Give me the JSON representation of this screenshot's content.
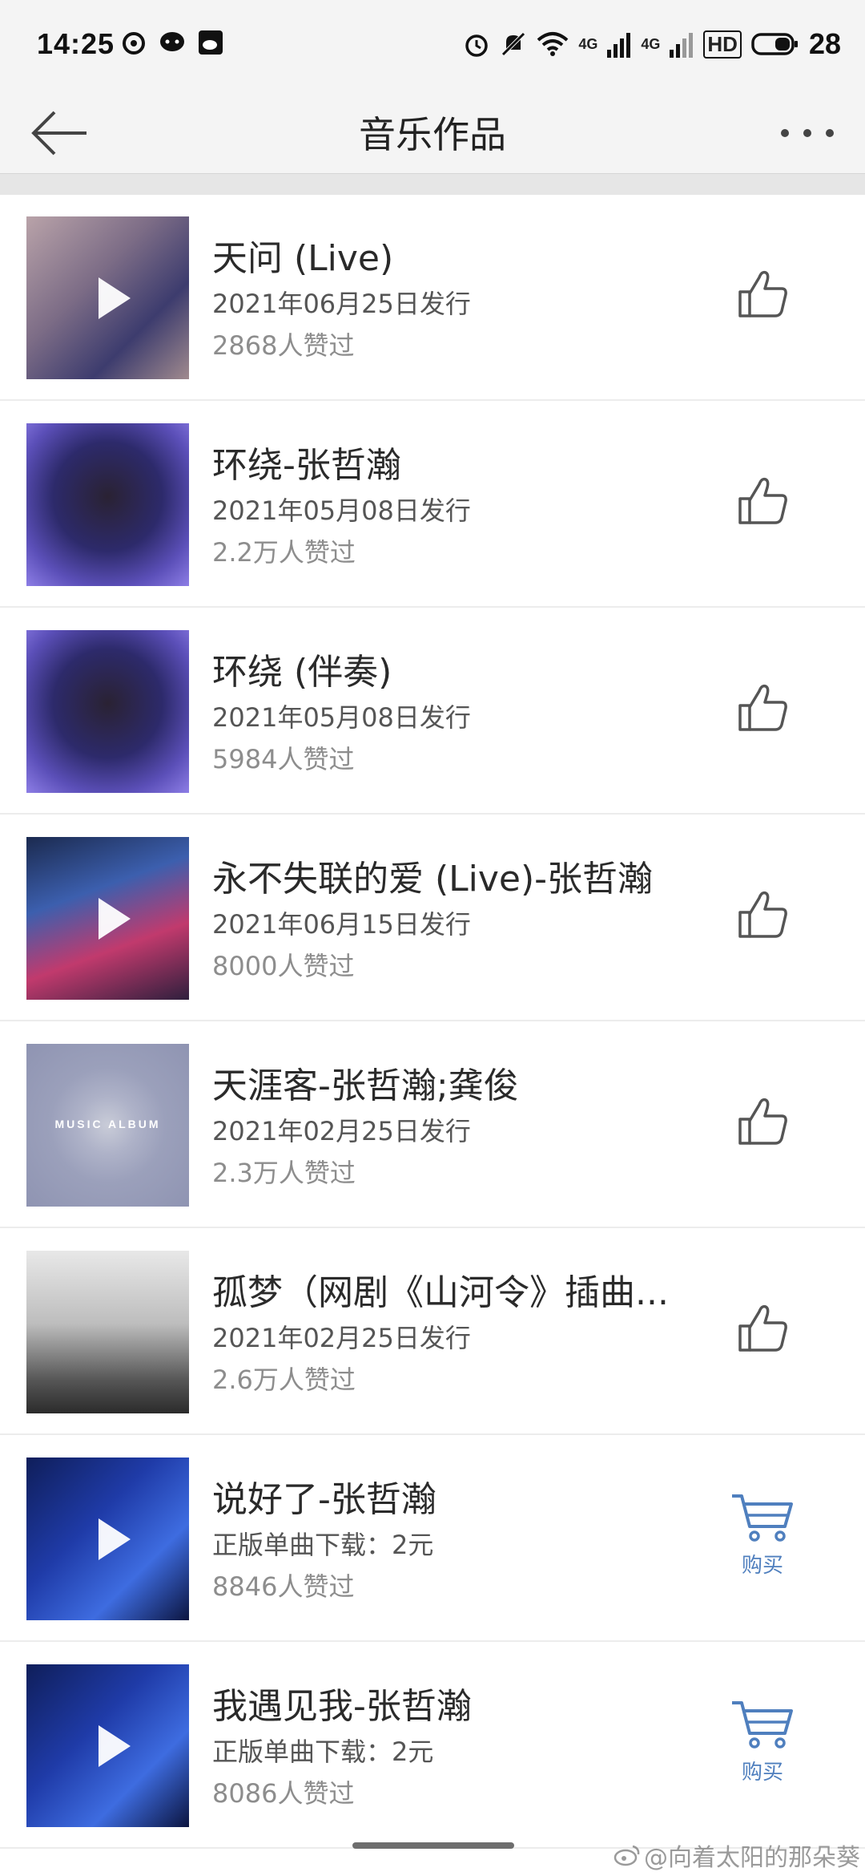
{
  "status": {
    "time": "14:25",
    "signal1": "4G",
    "signal2": "4G",
    "hd": "HD",
    "battery": "28"
  },
  "header": {
    "title": "音乐作品"
  },
  "songs": [
    {
      "title": "天问 (Live)",
      "sub": "2021年06月25日发行",
      "likes": "2868人赞过",
      "action": "like",
      "has_play": true
    },
    {
      "title": "环绕-张哲瀚",
      "sub": "2021年05月08日发行",
      "likes": "2.2万人赞过",
      "action": "like",
      "has_play": false
    },
    {
      "title": "环绕 (伴奏)",
      "sub": "2021年05月08日发行",
      "likes": "5984人赞过",
      "action": "like",
      "has_play": false
    },
    {
      "title": "永不失联的爱 (Live)-张哲瀚",
      "sub": "2021年06月15日发行",
      "likes": "8000人赞过",
      "action": "like",
      "has_play": true
    },
    {
      "title": "天涯客-张哲瀚;龚俊",
      "sub": "2021年02月25日发行",
      "likes": "2.3万人赞过",
      "action": "like",
      "has_play": false,
      "cover_text": "MUSIC ALBUM"
    },
    {
      "title": "孤梦（网剧《山河令》插曲...",
      "sub": "2021年02月25日发行",
      "likes": "2.6万人赞过",
      "action": "like",
      "has_play": false
    },
    {
      "title": "说好了-张哲瀚",
      "sub": "正版单曲下载：2元",
      "likes": "8846人赞过",
      "action": "buy",
      "has_play": true
    },
    {
      "title": "我遇见我-张哲瀚",
      "sub": "正版单曲下载：2元",
      "likes": "8086人赞过",
      "action": "buy",
      "has_play": true
    }
  ],
  "buy_label": "购买",
  "watermark": "@向着太阳的那朵葵",
  "colors": {
    "accent": "#4f7fbe",
    "background": "#ffffff",
    "bar": "#f4f4f4"
  }
}
